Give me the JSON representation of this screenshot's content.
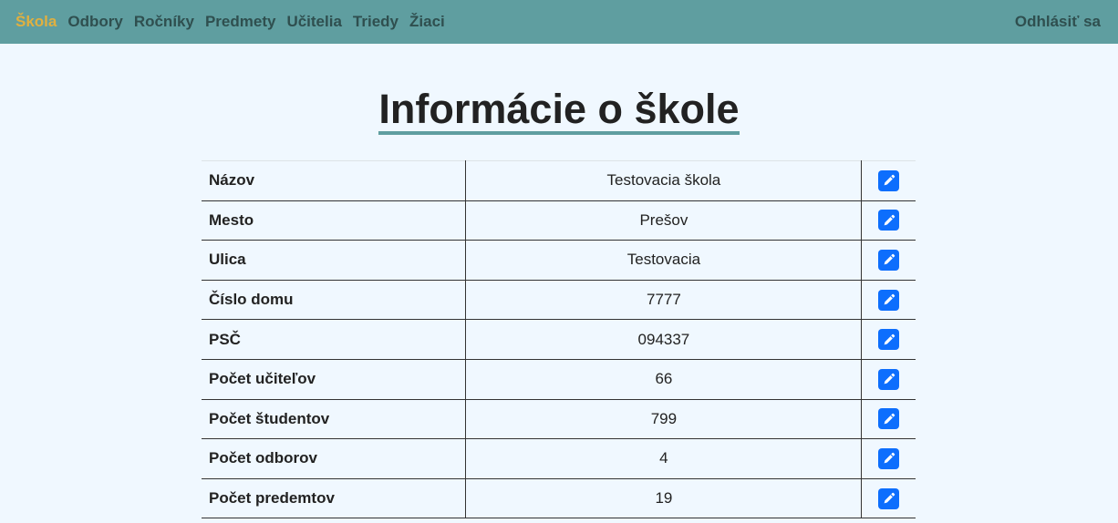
{
  "nav": {
    "items": [
      {
        "label": "Škola",
        "active": true
      },
      {
        "label": "Odbory",
        "active": false
      },
      {
        "label": "Ročníky",
        "active": false
      },
      {
        "label": "Predmety",
        "active": false
      },
      {
        "label": "Učitelia",
        "active": false
      },
      {
        "label": "Triedy",
        "active": false
      },
      {
        "label": "Žiaci",
        "active": false
      }
    ],
    "logout_label": "Odhlásiť sa"
  },
  "page": {
    "title": "Informácie o škole"
  },
  "table": {
    "rows": [
      {
        "label": "Názov",
        "value": "Testovacia škola",
        "action_icon": "pencil-icon"
      },
      {
        "label": "Mesto",
        "value": "Prešov",
        "action_icon": "pencil-icon"
      },
      {
        "label": "Ulica",
        "value": "Testovacia",
        "action_icon": "pencil-icon"
      },
      {
        "label": "Číslo domu",
        "value": "7777",
        "action_icon": "pencil-icon"
      },
      {
        "label": "PSČ",
        "value": "094337",
        "action_icon": "pencil-icon"
      },
      {
        "label": "Počet učiteľov",
        "value": "66",
        "action_icon": "pencil-icon"
      },
      {
        "label": "Počet študentov",
        "value": "799",
        "action_icon": "pencil-icon"
      },
      {
        "label": "Počet odborov",
        "value": "4",
        "action_icon": "pencil-icon"
      },
      {
        "label": "Počet predemtov",
        "value": "19",
        "action_icon": "pencil-icon"
      }
    ]
  },
  "colors": {
    "navbar_bg": "#5f9ea0",
    "nav_text": "#2f4f4f",
    "nav_active": "#e0b040",
    "page_bg": "#f0f8ff",
    "edit_button": "#0d6efd"
  }
}
